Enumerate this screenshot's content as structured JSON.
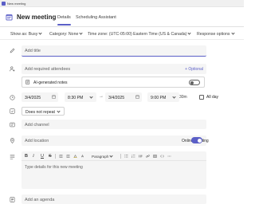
{
  "window": {
    "title": "New meeting"
  },
  "header": {
    "heading": "New meeting",
    "tabs": [
      {
        "label": "Details",
        "active": true
      },
      {
        "label": "Scheduling Assistant",
        "active": false
      }
    ]
  },
  "options": {
    "show_as": "Show as: Busy",
    "category": "Category: None",
    "time_zone": "Time zone: (UTC-05:00) Eastern Time (US & Canada)",
    "response_options": "Response options"
  },
  "form": {
    "title_placeholder": "Add title",
    "attendees_placeholder": "Add required attendees",
    "optional_label": "+ Optional",
    "ai_notes_label": "AI-generated notes",
    "ai_notes_enabled": false,
    "start_date": "3/4/2025",
    "start_time": "8:30 PM",
    "end_date": "3/4/2025",
    "end_time": "9:00 PM",
    "duration": "30m",
    "all_day_label": "All day",
    "all_day_checked": false,
    "repeat": "Does not repeat",
    "channel_placeholder": "Add channel",
    "location_placeholder": "Add location",
    "online_meeting_label": "Online meeting",
    "online_meeting_enabled": true,
    "editor_placeholder": "Type details for this new meeting",
    "paragraph_style": "Paragraph",
    "agenda_placeholder": "Add an agenda"
  },
  "colors": {
    "accent": "#5b5fc7",
    "field_bg": "#f5f5f5",
    "text": "#242424"
  },
  "icons": [
    "teams-app-icon",
    "calendar-icon",
    "pencil-icon",
    "people-add-icon",
    "ai-notes-icon",
    "clock-icon",
    "repeat-icon",
    "channel-icon",
    "location-icon",
    "text-lines-icon",
    "agenda-icon"
  ]
}
